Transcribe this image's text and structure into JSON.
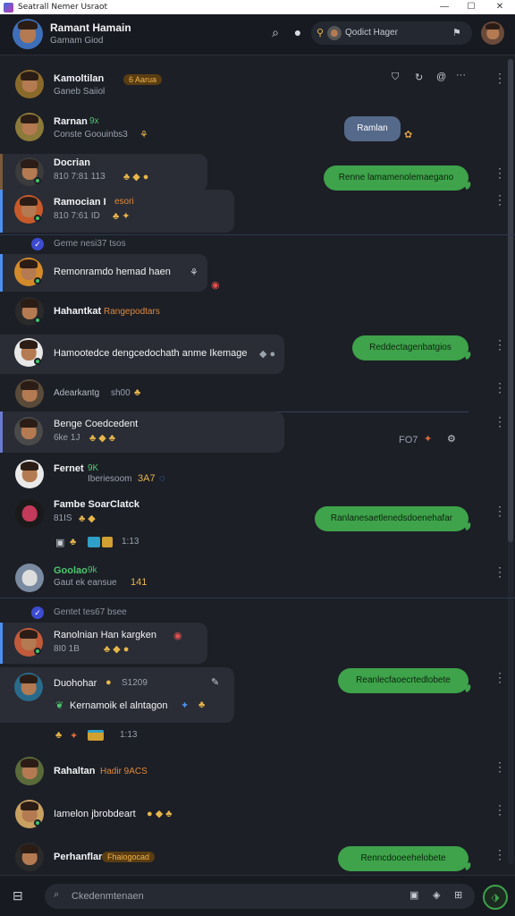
{
  "window": {
    "title": "Seatrall Nemer Usraot",
    "min": "—",
    "max": "☐",
    "close": "✕"
  },
  "header": {
    "name": "Ramant Hamain",
    "subtitle": "Gamam  Giod",
    "search_label": "Qodict Hager",
    "icons": [
      "search-icon",
      "chat-bubble-icon",
      "pin-icon",
      "bell-icon"
    ]
  },
  "messages": [
    {
      "name": "Kamoltilan",
      "badge": "6 Aarua",
      "meta": "Ganeb Saiiol",
      "emoji": "●"
    },
    {
      "name": "Rarnan",
      "name_suffix": "9x",
      "meta": "Conste Goouinbs3",
      "emoji": "⚘",
      "reply": "Ramlan"
    },
    {
      "name": "Docrian",
      "meta": "810 7:81 113",
      "emoji": "♣ ◆ ●",
      "reply": "Renne lamamenolemaegano"
    },
    {
      "name": "Ramocian I",
      "name_suffix": "esori",
      "meta": "810 7:61 ID",
      "emoji": "♣ ✦"
    },
    {
      "system": "Geme nesi37 tsos"
    },
    {
      "name": "Remonramdo hemad haen",
      "emoji": "⚘"
    },
    {
      "name": "Hahantkat",
      "tag": "Rangepodtars"
    },
    {
      "name": "Hamootedce dengcedochath anme Ikemage",
      "emoji": "◆ ●",
      "reply": "Reddectagenbatgios"
    },
    {
      "name": "Adearkantg",
      "meta": "sh00",
      "emoji": "♣"
    },
    {
      "name": "Benge Coedcedent",
      "meta": "6ke 1J",
      "emoji": "♣ ◆ ♣",
      "time": "FO7",
      "emoji_right": "✦"
    },
    {
      "name": "Fernet",
      "name_suffix": "9K",
      "meta": "Iberiesoom",
      "tag": "3A7"
    },
    {
      "name": "Fambe SoarClatck",
      "meta": "81IS",
      "emoji": "♣ ◆",
      "reply": "Ranlanesaetlenedsdoenehafar"
    },
    {
      "attachment_meta": "1:13"
    },
    {
      "name": "Goolao",
      "name_suffix": "9k",
      "meta": "Gaut ek eansue",
      "tag": "141"
    },
    {
      "system": "Gentet tes67 bsee"
    },
    {
      "name": "Ranolnian Han kargken",
      "meta": "8I0 1B",
      "emoji": "♣ ◆ ●"
    },
    {
      "name": "Duohohar",
      "meta": "S1209",
      "emoji": "●",
      "line2": "Kernamoik el alntagon",
      "reply": "Reanlecfaoecrtedlobete"
    },
    {
      "attachment_meta": "1:13"
    },
    {
      "name": "Rahaltan",
      "tag": "Hadir 9ACS"
    },
    {
      "name": "Iamelon jbrobdeart",
      "emoji": "● ◆ ♣"
    },
    {
      "name": "Perhanflar",
      "badge": "Fhaiogocad",
      "reply": "Renncdooeehelobete"
    }
  ],
  "composer": {
    "placeholder": "Ckedenmtenaen",
    "send_icon": "send-icon"
  },
  "colors": {
    "accent": "#4d8ff0",
    "bubble_green": "#3ea34a",
    "bg": "#1c1f26"
  }
}
